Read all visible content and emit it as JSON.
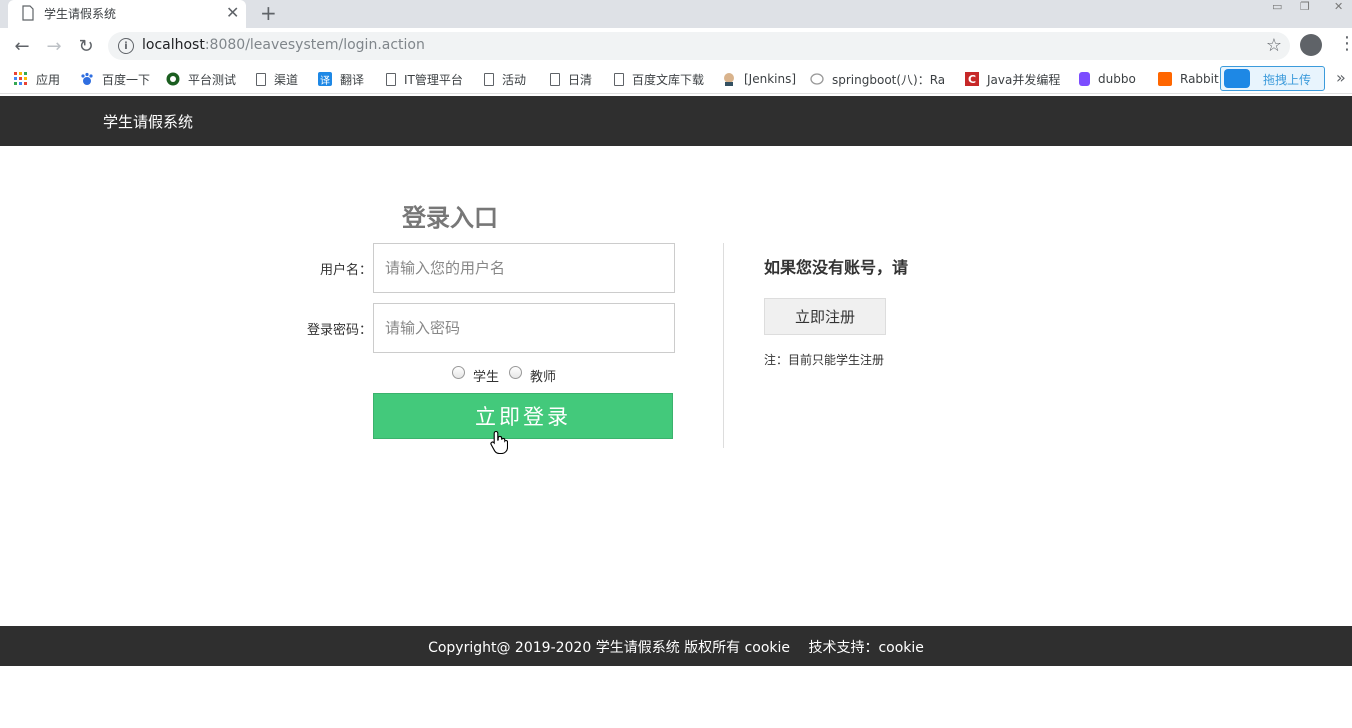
{
  "browser": {
    "tab_title": "学生请假系统",
    "url_host": "localhost",
    "url_rest": ":8080/leavesystem/login.action",
    "bookmarks": [
      {
        "label": "应用",
        "icon": "apps-grid-icon"
      },
      {
        "label": "百度一下",
        "icon": "baidu-paw-icon"
      },
      {
        "label": "平台测试",
        "icon": "platform-icon"
      },
      {
        "label": "渠道",
        "icon": "page-icon"
      },
      {
        "label": "翻译",
        "icon": "translate-icon"
      },
      {
        "label": "IT管理平台",
        "icon": "page-icon"
      },
      {
        "label": "活动",
        "icon": "page-icon"
      },
      {
        "label": "日清",
        "icon": "page-icon"
      },
      {
        "label": "百度文库下载",
        "icon": "page-icon"
      },
      {
        "label": "[Jenkins]",
        "icon": "jenkins-icon"
      },
      {
        "label": "springboot(八)：Ra",
        "icon": "springboot-icon"
      },
      {
        "label": "Java并发编程",
        "icon": "c-logo-icon"
      },
      {
        "label": "dubbo",
        "icon": "dubbo-icon"
      },
      {
        "label": "Rabbit",
        "icon": "rabbit-icon"
      }
    ],
    "upload_label": "拖拽上传",
    "more_bookmarks": "»"
  },
  "header": {
    "site_title": "学生请假系统"
  },
  "login": {
    "title": "登录入口",
    "username_label": "用户名：",
    "username_placeholder": "请输入您的用户名",
    "password_label": "登录密码：",
    "password_placeholder": "请输入密码",
    "role_student": "学生",
    "role_teacher": "教师",
    "submit_label": "立即登录"
  },
  "register": {
    "prompt": "如果您没有账号，请",
    "button_label": "立即注册",
    "note": "注：目前只能学生注册"
  },
  "footer": {
    "copyright": "Copyright@ 2019-2020 学生请假系统 版权所有 cookie　 技术支持：cookie"
  },
  "colors": {
    "header_bg": "#2f2f2f",
    "login_button": "#43c97b",
    "tab_strip": "#dee1e6"
  }
}
